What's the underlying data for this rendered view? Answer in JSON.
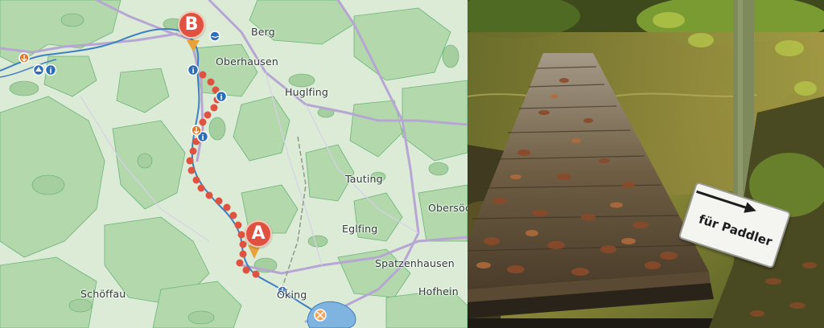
{
  "map": {
    "places": [
      "Berg",
      "Oberhausen",
      "Huglfing",
      "Tauting",
      "Obersöc",
      "Eglfing",
      "Spatzenhausen",
      "Hofhein",
      "Schöffau",
      "Oǩing"
    ],
    "markers": {
      "start": "A",
      "end": "B"
    },
    "icons": [
      "info-icon",
      "info-icon",
      "info-icon",
      "info-icon",
      "boat-launch-icon",
      "boat-launch-icon",
      "boat-launch-icon",
      "parking-icon",
      "sight-icon",
      "swimming-icon"
    ],
    "colors": {
      "route": "#e0523f",
      "forest": "#a9d1a3",
      "forest_edge": "#6cb37a",
      "water": "#3f7fbf",
      "road": "#b7a6d4",
      "land": "#dcebd6"
    }
  },
  "photo": {
    "subject": "wooden jetty covered in autumn leaves",
    "sign": {
      "text": "für Paddler",
      "arrow": "right-arrow-icon"
    },
    "colors": {
      "wood": "#7d6a4e",
      "leaves": "#8a4a2a",
      "foliage": "#6f8d2e"
    }
  }
}
